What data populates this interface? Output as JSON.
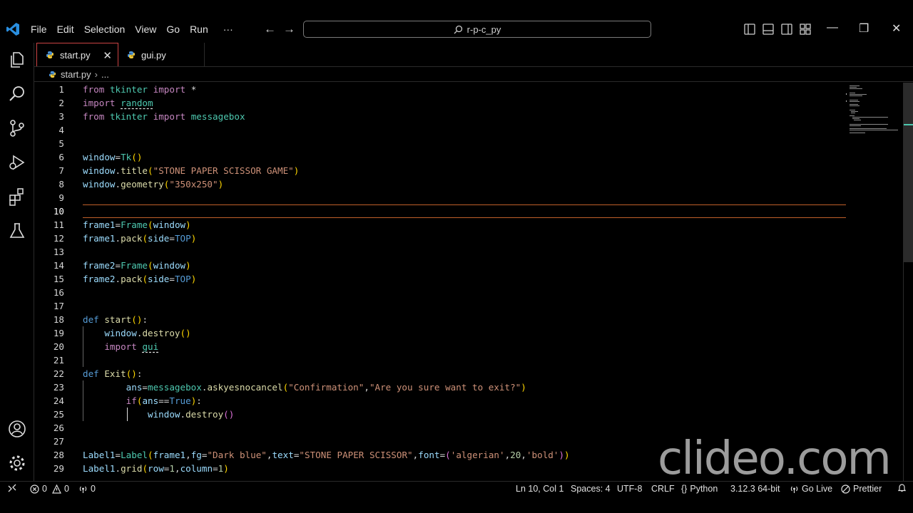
{
  "menu": [
    "File",
    "Edit",
    "Selection",
    "View",
    "Go",
    "Run",
    "···"
  ],
  "search": {
    "text": "r-p-c_py"
  },
  "tabs": [
    {
      "label": "start.py",
      "active": true
    },
    {
      "label": "gui.py",
      "active": false
    }
  ],
  "tab_close": "✕",
  "breadcrumb": {
    "file": "start.py",
    "rest": "..."
  },
  "editor": {
    "current_line": 10,
    "line_numbers": [
      "1",
      "2",
      "3",
      "4",
      "5",
      "6",
      "7",
      "8",
      "9",
      "10",
      "11",
      "12",
      "13",
      "14",
      "15",
      "16",
      "17",
      "18",
      "19",
      "20",
      "21",
      "22",
      "23",
      "24",
      "25",
      "26",
      "27",
      "28",
      "29"
    ]
  },
  "watermark": "clideo.com",
  "status": {
    "errors": "0",
    "warnings": "0",
    "ports": "0",
    "position": "Ln 10, Col 1",
    "spaces": "Spaces: 4",
    "encoding": "UTF-8",
    "eol": "CRLF",
    "language": "Python",
    "interpreter": "3.12.3 64-bit",
    "golive": "Go Live",
    "prettier": "Prettier"
  },
  "colors": {
    "accent_current_line": "#c0602a",
    "active_tab_border": "#cc4444",
    "keyword": "#c586c0",
    "string": "#ce9178",
    "class": "#4ec9b0",
    "function": "#dcdcaa",
    "variable": "#9cdcfe"
  }
}
